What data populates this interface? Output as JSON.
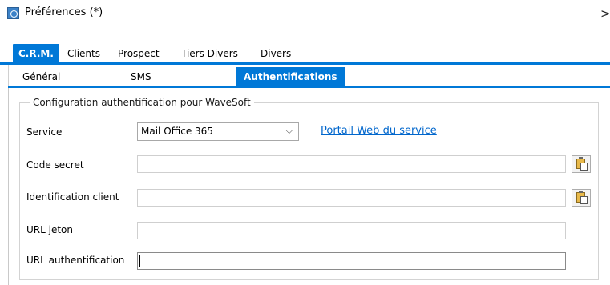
{
  "window": {
    "title": "Préférences (*)",
    "close_glyph": ">"
  },
  "tabs_level1": [
    {
      "label": "C.R.M.",
      "active": true
    },
    {
      "label": "Clients",
      "active": false
    },
    {
      "label": "Prospect",
      "active": false
    },
    {
      "label": "Tiers Divers",
      "active": false
    },
    {
      "label": "Divers",
      "active": false
    }
  ],
  "tabs_level2": [
    {
      "label": "Général",
      "active": false
    },
    {
      "label": "SMS",
      "active": false
    },
    {
      "label": "Authentifications",
      "active": true
    }
  ],
  "group": {
    "title": "Configuration authentification pour WaveSoft"
  },
  "form": {
    "service_label": "Service",
    "service_value": "Mail Office 365",
    "portal_link": "Portail Web du service",
    "code_secret_label": "Code secret",
    "code_secret_value": "",
    "identification_label": "Identification client",
    "identification_value": "",
    "url_jeton_label": "URL jeton",
    "url_jeton_value": "",
    "url_auth_label": "URL authentification",
    "url_auth_value": ""
  },
  "colors": {
    "accent": "#0078d7",
    "link": "#0066cc"
  }
}
